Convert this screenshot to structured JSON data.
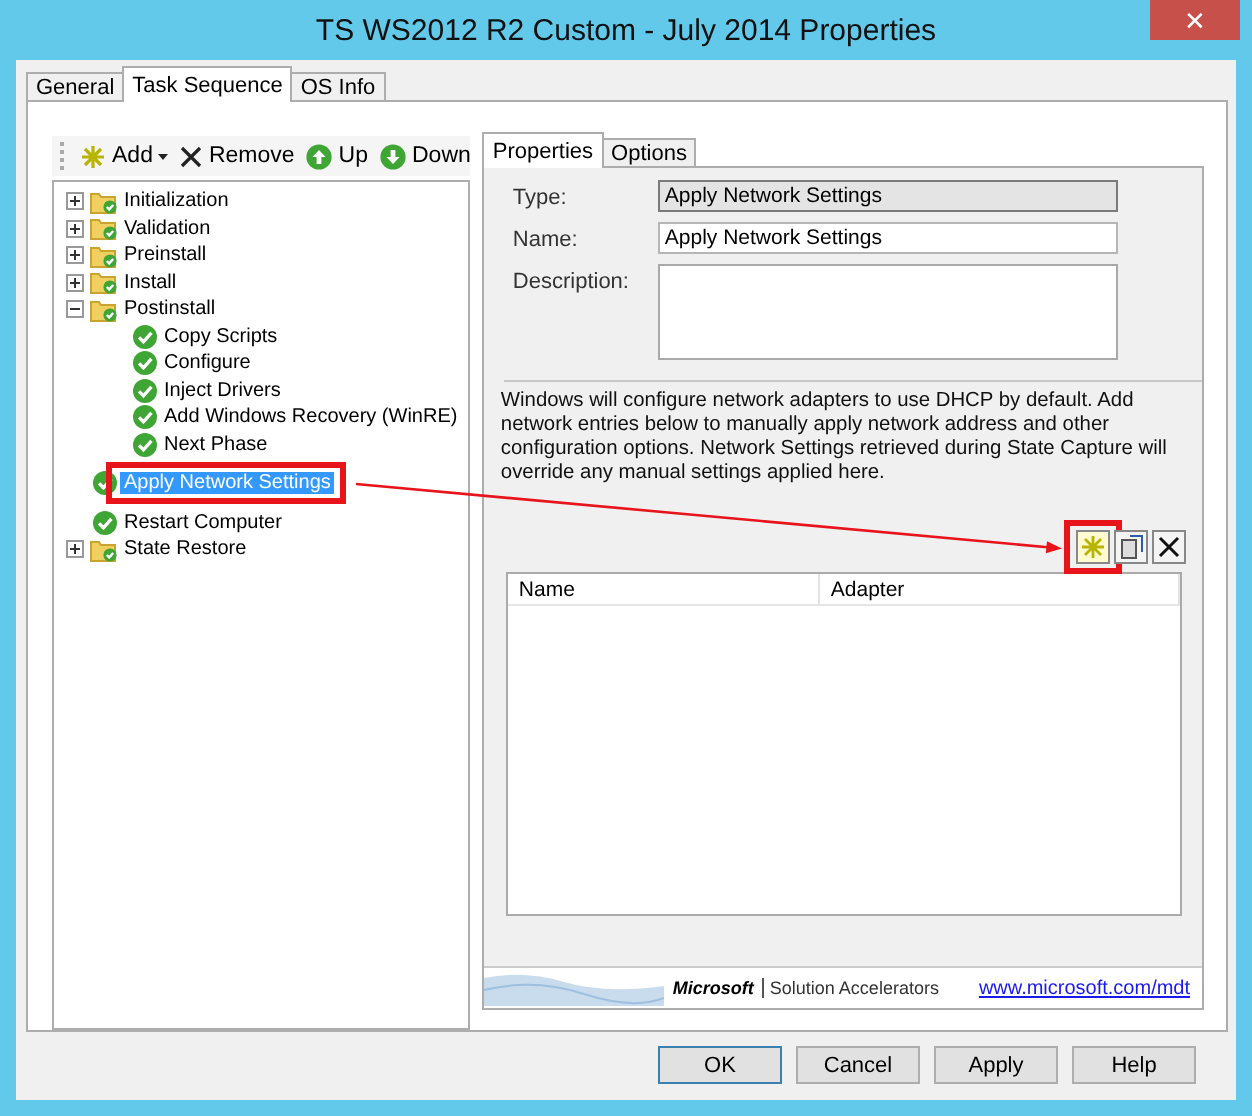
{
  "window": {
    "title": "TS WS2012 R2 Custom - July 2014 Properties",
    "close": "✕"
  },
  "tabs": [
    {
      "label": "General",
      "selected": false
    },
    {
      "label": "Task Sequence",
      "selected": true
    },
    {
      "label": "OS Info",
      "selected": false
    }
  ],
  "toolbar": [
    {
      "kind": "add",
      "label": "Add",
      "dropdown": true
    },
    {
      "kind": "remove",
      "label": "Remove",
      "dropdown": false
    },
    {
      "kind": "up",
      "label": "Up",
      "dropdown": false
    },
    {
      "kind": "down",
      "label": "Down",
      "dropdown": false
    }
  ],
  "tree": [
    {
      "kind": "folder",
      "label": "Initialization",
      "expanded": false,
      "selected": false
    },
    {
      "kind": "folder",
      "label": "Validation",
      "expanded": false,
      "selected": false
    },
    {
      "kind": "folder",
      "label": "Preinstall",
      "expanded": false,
      "selected": false
    },
    {
      "kind": "folder",
      "label": "Install",
      "expanded": false,
      "selected": false
    },
    {
      "kind": "folder",
      "label": "Postinstall",
      "expanded": true,
      "selected": false,
      "children": [
        {
          "kind": "step",
          "label": "Copy Scripts",
          "selected": false
        },
        {
          "kind": "step",
          "label": "Configure",
          "selected": false
        },
        {
          "kind": "step",
          "label": "Inject Drivers",
          "selected": false
        },
        {
          "kind": "step",
          "label": "Add Windows Recovery (WinRE)",
          "selected": false
        },
        {
          "kind": "step",
          "label": "Next Phase",
          "selected": false
        }
      ]
    },
    {
      "kind": "step",
      "label": "Apply Network Settings",
      "selected": true
    },
    {
      "kind": "step",
      "label": "Restart Computer",
      "selected": false
    },
    {
      "kind": "folder",
      "label": "State Restore",
      "expanded": false,
      "selected": false
    }
  ],
  "inner_tabs": [
    {
      "label": "Properties",
      "selected": true
    },
    {
      "label": "Options",
      "selected": false
    }
  ],
  "fields": [
    {
      "label": "Type:",
      "value": "Apply Network Settings",
      "disabled": true
    },
    {
      "label": "Name:",
      "value": "Apply Network Settings",
      "disabled": false
    }
  ],
  "description": {
    "label": "Description:"
  },
  "info_text": "Windows will configure network adapters to use DHCP by default. Add network entries below to manually apply network address and other configuration options. Network Settings retrieved during State Capture will override any manual settings applied here.",
  "list_actions": [
    {
      "kind": "new",
      "highlighted": true
    },
    {
      "kind": "properties",
      "highlighted": false
    },
    {
      "kind": "delete",
      "highlighted": false
    }
  ],
  "table": {
    "columns": [
      "Name",
      "Adapter"
    ]
  },
  "footer": {
    "brand": "Microsoft",
    "product": "Solution Accelerators",
    "link": "www.microsoft.com/mdt"
  },
  "buttons": [
    {
      "label": "OK",
      "default": true
    },
    {
      "label": "Cancel",
      "default": false
    },
    {
      "label": "Apply",
      "default": false
    },
    {
      "label": "Help",
      "default": false
    }
  ]
}
